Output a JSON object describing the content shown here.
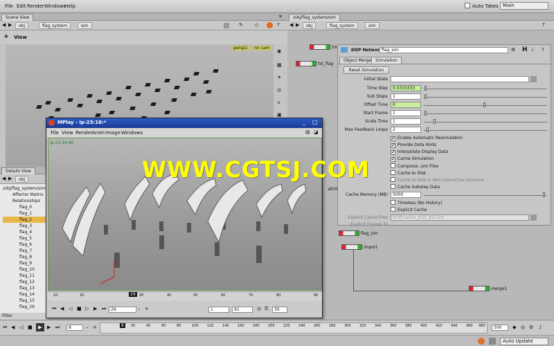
{
  "menu": {
    "file": "File",
    "edit": "Edit",
    "render": "Render",
    "windows": "Windows",
    "help": "Help"
  },
  "topright": {
    "auto_takes": "Auto Takes",
    "main": "Main"
  },
  "scene": {
    "tab": "Scene View",
    "crumb_obj": "obj",
    "crumb_flag": "flag_system",
    "crumb_sim": "sim",
    "view_label": "View",
    "persp": "persp1",
    "nocam": "no cam"
  },
  "network": {
    "tab": "/obj/flag_system/sim",
    "crumb_obj": "obj",
    "crumb_flag": "flag_system",
    "crumb_sim": "sim",
    "node_top_label": "tm",
    "fxt_flag": "fxt_flag",
    "attrib": "attrib",
    "flag_sim": "flag_sim",
    "import": "import",
    "merge": "merge1"
  },
  "params": {
    "type_label": "DOP Network",
    "name": "flag_sim",
    "tabs": [
      "Object Merge",
      "Simulation"
    ],
    "reset": "Reset Simulation",
    "initial_state": "Initial State",
    "time_step": {
      "label": "Time Step",
      "value": "0.0333333"
    },
    "sub_steps": {
      "label": "Sub Steps",
      "value": "1"
    },
    "offset_time": {
      "label": "Offset Time",
      "value": "0"
    },
    "start_frame": {
      "label": "Start Frame",
      "value": "1"
    },
    "scale_time": {
      "label": "Scale Time",
      "value": "1"
    },
    "max_feedback": {
      "label": "Max Feedback Loops",
      "value": "2"
    },
    "checks": [
      {
        "label": "Enable Automatic Resimulation",
        "checked": true
      },
      {
        "label": "Provide Data Hints",
        "checked": true
      },
      {
        "label": "Interpolate Display Data",
        "checked": true
      },
      {
        "label": "Cache Simulation",
        "checked": true
      },
      {
        "label": "Compress .sim Files",
        "checked": false
      },
      {
        "label": "Cache to Disk",
        "checked": false
      },
      {
        "label": "Cache to Disk in Non-Interactive Sessions",
        "checked": false
      },
      {
        "label": "Cache Substep Data",
        "checked": false
      }
    ],
    "cache_memory": {
      "label": "Cache Memory (MB)",
      "value": "5000"
    },
    "timeless": "Timeless (No History)",
    "explicit_cache": "Explicit Cache",
    "explicit_files": {
      "label": "Explicit Cache Files",
      "value": "$HIP/cache_$OS_$SF.sim"
    },
    "explicit_frames": "Explicit Frames To"
  },
  "details": {
    "tab": "Details View",
    "crumb": "obj",
    "path": "/obj/flag_system/sim",
    "items": [
      "Affector Matrix",
      "Relationships",
      "flag_0",
      "flag_1",
      "flag_2",
      "flag_3",
      "flag_4",
      "flag_5",
      "flag_6",
      "flag_7",
      "flag_8",
      "flag_9",
      "flag_10",
      "flag_11",
      "flag_12",
      "flag_13",
      "flag_14",
      "flag_15",
      "flag_16"
    ],
    "filter": "Filter"
  },
  "mplay": {
    "title": "MPlay - ip-23:16:*",
    "menus": [
      "File",
      "View",
      "Render",
      "Anim",
      "Image",
      "Windows"
    ],
    "overlay": "ip-23:16:40",
    "ticks": [
      "10",
      "20",
      "29",
      "30",
      "40",
      "50",
      "60",
      "70",
      "80",
      "90"
    ],
    "current": "29",
    "frame": "29",
    "start": "1",
    "end": "91",
    "inc": "30"
  },
  "timeline": {
    "ticks": [
      "20",
      "40",
      "60",
      "80",
      "100",
      "120",
      "140",
      "160",
      "180",
      "200",
      "220",
      "240",
      "260",
      "280",
      "300",
      "320",
      "340",
      "360",
      "380",
      "400",
      "420",
      "440",
      "460",
      "480"
    ],
    "current": "8",
    "start": "8",
    "end": "500",
    "auto_update": "Auto Update"
  },
  "watermark": "WWW.CGTSJ.COM"
}
